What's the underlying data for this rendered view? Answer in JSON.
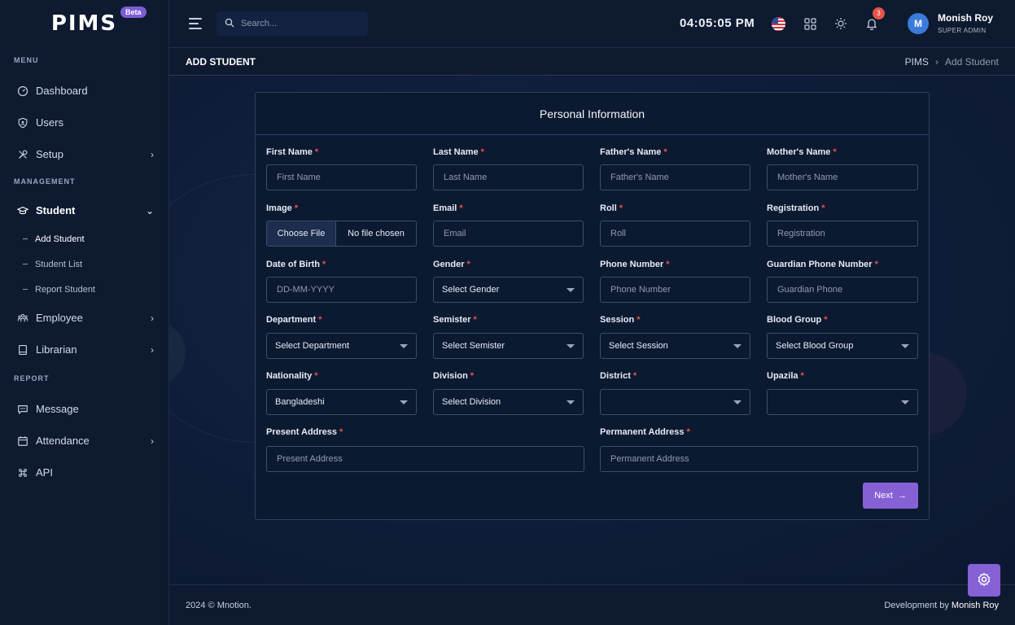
{
  "brand": {
    "logo": "PIMS",
    "badge": "Beta"
  },
  "sidebar": {
    "menu_heading": "MENU",
    "management_heading": "MANAGEMENT",
    "report_heading": "REPORT",
    "items": {
      "dashboard": "Dashboard",
      "users": "Users",
      "setup": "Setup",
      "student": "Student",
      "add_student": "Add Student",
      "student_list": "Student List",
      "report_student": "Report Student",
      "employee": "Employee",
      "librarian": "Librarian",
      "message": "Message",
      "attendance": "Attendance",
      "api": "API"
    }
  },
  "topbar": {
    "search_placeholder": "Search...",
    "clock": "04:05:05 PM",
    "notification_count": "3",
    "avatar_initial": "M",
    "user_name": "Monish Roy",
    "user_role": "SUPER ADMIN"
  },
  "page": {
    "title": "ADD STUDENT",
    "breadcrumb_root": "PIMS",
    "breadcrumb_sep": "›",
    "breadcrumb_current": "Add Student"
  },
  "form": {
    "title": "Personal Information",
    "required_mark": "*",
    "first_name": {
      "label": "First Name",
      "placeholder": "First Name",
      "value": ""
    },
    "last_name": {
      "label": "Last Name",
      "placeholder": "Last Name",
      "value": ""
    },
    "father_name": {
      "label": "Father's Name",
      "placeholder": "Father's Name",
      "value": ""
    },
    "mother_name": {
      "label": "Mother's Name",
      "placeholder": "Mother's Name",
      "value": ""
    },
    "image": {
      "label": "Image",
      "button": "Choose File",
      "status": "No file chosen"
    },
    "email": {
      "label": "Email",
      "placeholder": "Email",
      "value": ""
    },
    "roll": {
      "label": "Roll",
      "placeholder": "Roll",
      "value": ""
    },
    "registration": {
      "label": "Registration",
      "placeholder": "Registration",
      "value": ""
    },
    "dob": {
      "label": "Date of Birth",
      "placeholder": "DD-MM-YYYY",
      "value": ""
    },
    "gender": {
      "label": "Gender",
      "selected": "Select Gender"
    },
    "phone": {
      "label": "Phone Number",
      "placeholder": "Phone Number",
      "value": ""
    },
    "guardian_phone": {
      "label": "Guardian Phone Number",
      "placeholder": "Guardian Phone",
      "value": ""
    },
    "department": {
      "label": "Department",
      "selected": "Select Department"
    },
    "semister": {
      "label": "Semister",
      "selected": "Select Semister"
    },
    "session": {
      "label": "Session",
      "selected": "Select Session"
    },
    "blood_group": {
      "label": "Blood Group",
      "selected": "Select Blood Group"
    },
    "nationality": {
      "label": "Nationality",
      "selected": "Bangladeshi"
    },
    "division": {
      "label": "Division",
      "selected": "Select Division"
    },
    "district": {
      "label": "District",
      "selected": ""
    },
    "upazila": {
      "label": "Upazila",
      "selected": ""
    },
    "present_address": {
      "label": "Present Address",
      "placeholder": "Present Address",
      "value": ""
    },
    "permanent_address": {
      "label": "Permanent Address",
      "placeholder": "Permanent Address",
      "value": ""
    },
    "next_button": "Next",
    "next_arrow": "→"
  },
  "footer": {
    "copyright": "2024 © Mnotion.",
    "credit_prefix": "Development by",
    "credit_name": "Monish Roy"
  },
  "colors": {
    "accent": "#8661d6",
    "required": "#e5544b",
    "avatar": "#3b7ad9",
    "background": "#0d1a33"
  },
  "icons": {
    "dashboard": "gauge-icon",
    "users": "shield-user-icon",
    "setup": "tools-icon",
    "student": "graduation-cap-icon",
    "employee": "team-icon",
    "librarian": "book-icon",
    "message": "chat-icon",
    "attendance": "calendar-icon",
    "api": "command-icon",
    "settings": "gear-icon"
  }
}
